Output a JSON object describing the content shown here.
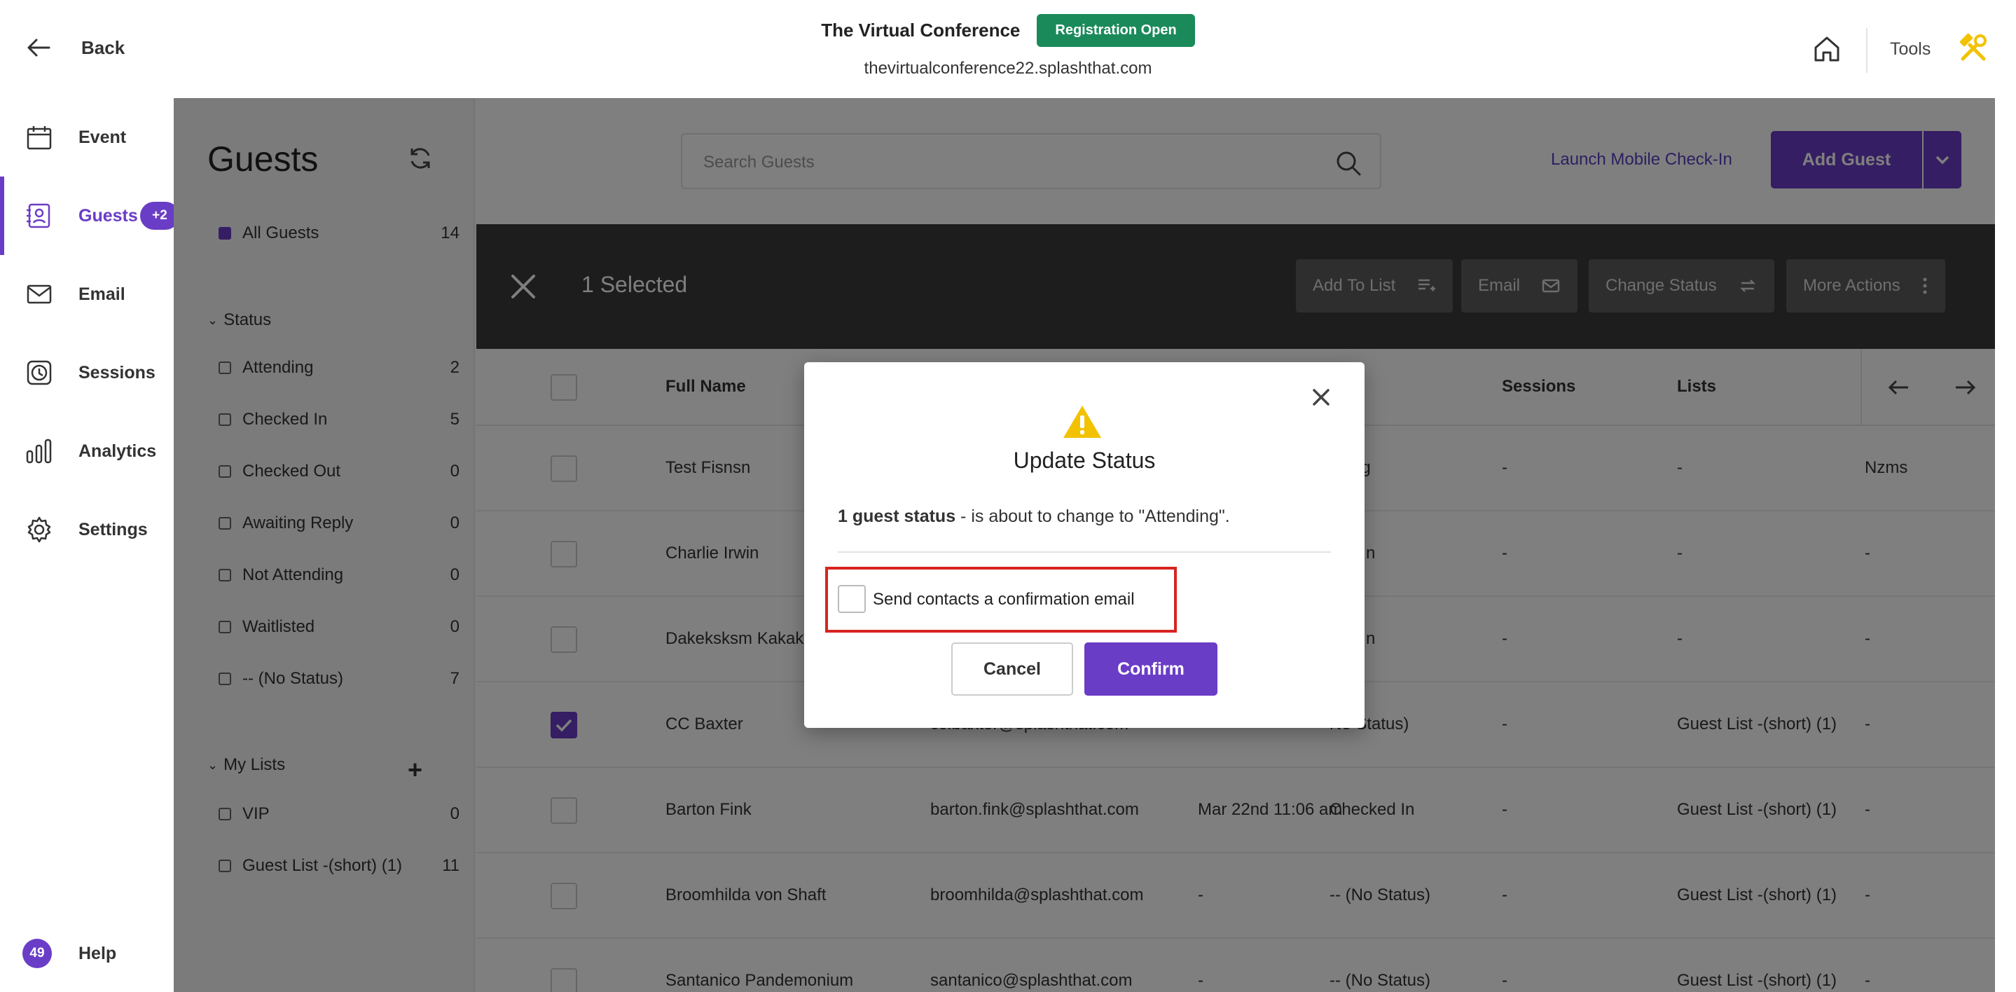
{
  "header": {
    "back_label": "Back",
    "event_name": "The Virtual Conference",
    "registration_badge": "Registration Open",
    "event_url": "thevirtualconference22.splashthat.com",
    "tools_label": "Tools"
  },
  "nav": {
    "items": [
      {
        "label": "Event",
        "icon": "calendar-icon"
      },
      {
        "label": "Guests",
        "icon": "guest-card-icon",
        "badge": "+2",
        "active": true
      },
      {
        "label": "Email",
        "icon": "envelope-icon"
      },
      {
        "label": "Sessions",
        "icon": "clock-icon"
      },
      {
        "label": "Analytics",
        "icon": "bar-chart-icon"
      },
      {
        "label": "Settings",
        "icon": "gear-icon"
      }
    ],
    "help_count": "49",
    "help_label": "Help"
  },
  "filters": {
    "title": "Guests",
    "all_guests": {
      "label": "All Guests",
      "count": "14"
    },
    "status_heading": "Status",
    "statuses": [
      {
        "label": "Attending",
        "count": "2"
      },
      {
        "label": "Checked In",
        "count": "5"
      },
      {
        "label": "Checked Out",
        "count": "0"
      },
      {
        "label": "Awaiting Reply",
        "count": "0"
      },
      {
        "label": "Not Attending",
        "count": "0"
      },
      {
        "label": "Waitlisted",
        "count": "0"
      },
      {
        "label": "-- (No Status)",
        "count": "7"
      }
    ],
    "lists_heading": "My Lists",
    "lists": [
      {
        "label": "VIP",
        "count": "0"
      },
      {
        "label": "Guest List -(short) (1)",
        "count": "11"
      }
    ]
  },
  "toolbar": {
    "search_placeholder": "Search Guests",
    "mobile_checkin": "Launch Mobile Check-In",
    "add_guest": "Add Guest"
  },
  "selection": {
    "count_label": "1 Selected",
    "add_to_list": "Add To List",
    "email": "Email",
    "change_status": "Change Status",
    "more_actions": "More Actions"
  },
  "table": {
    "columns": [
      "Full Name",
      "s",
      "Sessions",
      "Lists"
    ],
    "rows": [
      {
        "name": "Test Fisnsn",
        "email": "",
        "date": "",
        "status": "nding",
        "sessions": "-",
        "lists": "-",
        "extra": "Nzms",
        "checked": false
      },
      {
        "name": "Charlie Irwin",
        "email": "",
        "date": "",
        "status": "ked In",
        "sessions": "-",
        "lists": "-",
        "extra": "-",
        "checked": false
      },
      {
        "name": "Dakeksksm Kakaka",
        "email": "",
        "date": "",
        "status": "ked In",
        "sessions": "-",
        "lists": "-",
        "extra": "-",
        "checked": false
      },
      {
        "name": "CC Baxter",
        "email": "cc.baxter@splashthat.com",
        "date": "",
        "status": "No Status)",
        "sessions": "-",
        "lists": "Guest List -(short) (1)",
        "extra": "-",
        "checked": true
      },
      {
        "name": "Barton Fink",
        "email": "barton.fink@splashthat.com",
        "date": "Mar 22nd 11:06 am",
        "status": "Checked In",
        "sessions": "-",
        "lists": "Guest List -(short) (1)",
        "extra": "-",
        "checked": false
      },
      {
        "name": "Broomhilda von Shaft",
        "email": "broomhilda@splashthat.com",
        "date": "-",
        "status": "-- (No Status)",
        "sessions": "-",
        "lists": "Guest List -(short) (1)",
        "extra": "-",
        "checked": false
      },
      {
        "name": "Santanico Pandemonium",
        "email": "santanico@splashthat.com",
        "date": "-",
        "status": "-- (No Status)",
        "sessions": "-",
        "lists": "Guest List -(short) (1)",
        "extra": "-",
        "checked": false
      }
    ]
  },
  "modal": {
    "title": "Update Status",
    "message_bold": "1 guest status",
    "message_rest": " - is about to change to \"Attending\".",
    "checkbox_label": "Send contacts a confirmation email",
    "cancel": "Cancel",
    "confirm": "Confirm"
  },
  "colors": {
    "accent": "#6a3dc6",
    "registration_green": "#1b8a5a",
    "highlight_red": "#d7241f"
  }
}
